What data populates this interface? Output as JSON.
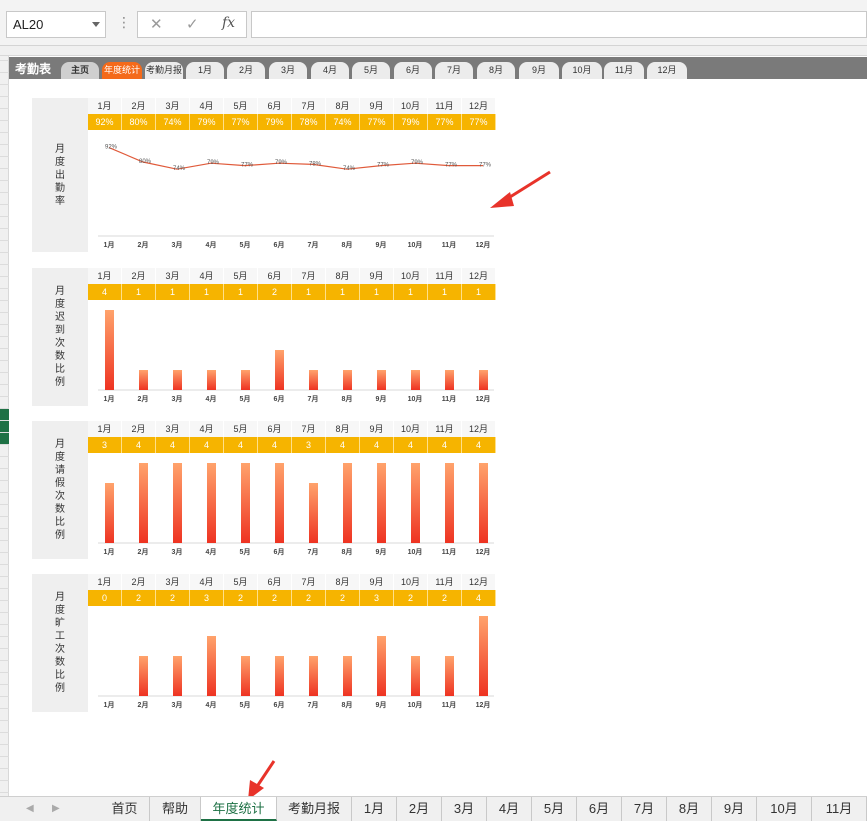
{
  "formula_bar": {
    "name_box": "AL20",
    "fx_label": "fx",
    "formula": ""
  },
  "app": {
    "title": "考勤表",
    "tabs": [
      "主页",
      "年度统计",
      "考勤月报",
      "1月",
      "2月",
      "3月",
      "4月",
      "5月",
      "6月",
      "7月",
      "8月",
      "9月",
      "10月",
      "11月",
      "12月"
    ],
    "active_tab": "年度统计",
    "accent_color": "#f46a1a"
  },
  "months": [
    "1月",
    "2月",
    "3月",
    "4月",
    "5月",
    "6月",
    "7月",
    "8月",
    "9月",
    "10月",
    "11月",
    "12月"
  ],
  "colors": {
    "value_band": "#f6b400",
    "bar_top": "#ffa36c",
    "bar_bottom": "#ee3322",
    "line": "#e05a3a"
  },
  "blocks": [
    {
      "label": "月度出勤率",
      "values": [
        "92%",
        "80%",
        "74%",
        "79%",
        "77%",
        "79%",
        "78%",
        "74%",
        "77%",
        "79%",
        "77%",
        "77%"
      ],
      "chart_data": {
        "type": "line",
        "categories": [
          "1月",
          "2月",
          "3月",
          "4月",
          "5月",
          "6月",
          "7月",
          "8月",
          "9月",
          "10月",
          "11月",
          "12月"
        ],
        "values": [
          92,
          80,
          74,
          79,
          77,
          79,
          78,
          74,
          77,
          79,
          77,
          77
        ],
        "ylim": [
          0,
          100
        ]
      }
    },
    {
      "label": "月度迟到次数比例",
      "values": [
        "4",
        "1",
        "1",
        "1",
        "1",
        "2",
        "1",
        "1",
        "1",
        "1",
        "1",
        "1"
      ],
      "chart_data": {
        "type": "bar",
        "categories": [
          "1月",
          "2月",
          "3月",
          "4月",
          "5月",
          "6月",
          "7月",
          "8月",
          "9月",
          "10月",
          "11月",
          "12月"
        ],
        "values": [
          4,
          1,
          1,
          1,
          1,
          2,
          1,
          1,
          1,
          1,
          1,
          1
        ],
        "ylim": [
          0,
          4
        ]
      }
    },
    {
      "label": "月度请假次数比例",
      "values": [
        "3",
        "4",
        "4",
        "4",
        "4",
        "4",
        "3",
        "4",
        "4",
        "4",
        "4",
        "4"
      ],
      "chart_data": {
        "type": "bar",
        "categories": [
          "1月",
          "2月",
          "3月",
          "4月",
          "5月",
          "6月",
          "7月",
          "8月",
          "9月",
          "10月",
          "11月",
          "12月"
        ],
        "values": [
          3,
          4,
          4,
          4,
          4,
          4,
          3,
          4,
          4,
          4,
          4,
          4
        ],
        "ylim": [
          0,
          4
        ]
      }
    },
    {
      "label": "月度旷工次数比例",
      "values": [
        "0",
        "2",
        "2",
        "3",
        "2",
        "2",
        "2",
        "2",
        "3",
        "2",
        "2",
        "4"
      ],
      "chart_data": {
        "type": "bar",
        "categories": [
          "1月",
          "2月",
          "3月",
          "4月",
          "5月",
          "6月",
          "7月",
          "8月",
          "9月",
          "10月",
          "11月",
          "12月"
        ],
        "values": [
          0,
          2,
          2,
          3,
          2,
          2,
          2,
          2,
          3,
          2,
          2,
          4
        ],
        "ylim": [
          0,
          4
        ]
      }
    }
  ],
  "sheet_tabs": [
    "首页",
    "帮助",
    "年度统计",
    "考勤月报",
    "1月",
    "2月",
    "3月",
    "4月",
    "5月",
    "6月",
    "7月",
    "8月",
    "9月",
    "10月",
    "11月"
  ],
  "active_sheet": "年度统计"
}
